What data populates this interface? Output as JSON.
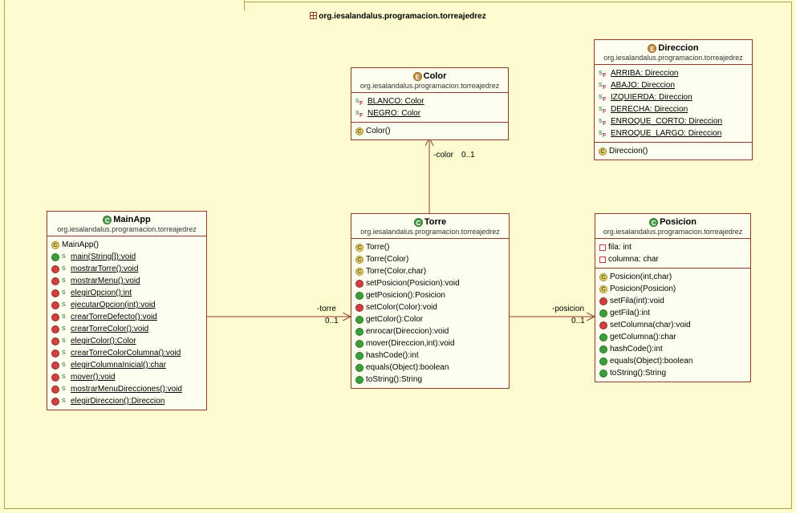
{
  "package": {
    "name": "org.iesalandalus.programacion.torreajedrez"
  },
  "classes": {
    "mainapp": {
      "stereotype": "class",
      "name": "MainApp",
      "package": "org.iesalandalus.programacion.torreajedrez",
      "attributes": [],
      "operations": [
        {
          "vis": "public",
          "static": false,
          "constructor": true,
          "sig": "MainApp()"
        },
        {
          "vis": "public",
          "static": true,
          "constructor": false,
          "sig": "main(String[]):void"
        },
        {
          "vis": "private",
          "static": true,
          "constructor": false,
          "sig": "mostrarTorre():void"
        },
        {
          "vis": "private",
          "static": true,
          "constructor": false,
          "sig": "mostrarMenu():void"
        },
        {
          "vis": "private",
          "static": true,
          "constructor": false,
          "sig": "elegirOpcion():int"
        },
        {
          "vis": "private",
          "static": true,
          "constructor": false,
          "sig": "ejecutarOpcion(int):void"
        },
        {
          "vis": "private",
          "static": true,
          "constructor": false,
          "sig": "crearTorreDefecto():void"
        },
        {
          "vis": "private",
          "static": true,
          "constructor": false,
          "sig": "crearTorreColor():void"
        },
        {
          "vis": "private",
          "static": true,
          "constructor": false,
          "sig": "elegirColor():Color"
        },
        {
          "vis": "private",
          "static": true,
          "constructor": false,
          "sig": "crearTorreColorColumna():void"
        },
        {
          "vis": "private",
          "static": true,
          "constructor": false,
          "sig": "elegirColumnaInicial():char"
        },
        {
          "vis": "private",
          "static": true,
          "constructor": false,
          "sig": "mover():void"
        },
        {
          "vis": "private",
          "static": true,
          "constructor": false,
          "sig": "mostrarMenuDirecciones():void"
        },
        {
          "vis": "private",
          "static": true,
          "constructor": false,
          "sig": "elegirDireccion():Direccion"
        }
      ]
    },
    "torre": {
      "stereotype": "class",
      "name": "Torre",
      "package": "org.iesalandalus.programacion.torreajedrez",
      "attributes": [],
      "operations": [
        {
          "vis": "public",
          "static": false,
          "constructor": true,
          "sig": "Torre()"
        },
        {
          "vis": "public",
          "static": false,
          "constructor": true,
          "sig": "Torre(Color)"
        },
        {
          "vis": "public",
          "static": false,
          "constructor": true,
          "sig": "Torre(Color,char)"
        },
        {
          "vis": "private",
          "static": false,
          "constructor": false,
          "sig": "setPosicion(Posicion):void"
        },
        {
          "vis": "public",
          "static": false,
          "constructor": false,
          "sig": "getPosicion():Posicion"
        },
        {
          "vis": "private",
          "static": false,
          "constructor": false,
          "sig": "setColor(Color):void"
        },
        {
          "vis": "public",
          "static": false,
          "constructor": false,
          "sig": "getColor():Color"
        },
        {
          "vis": "public",
          "static": false,
          "constructor": false,
          "sig": "enrocar(Direccion):void"
        },
        {
          "vis": "public",
          "static": false,
          "constructor": false,
          "sig": "mover(Direccion,int):void"
        },
        {
          "vis": "public",
          "static": false,
          "constructor": false,
          "sig": "hashCode():int"
        },
        {
          "vis": "public",
          "static": false,
          "constructor": false,
          "sig": "equals(Object):boolean"
        },
        {
          "vis": "public",
          "static": false,
          "constructor": false,
          "sig": "toString():String"
        }
      ]
    },
    "posicion": {
      "stereotype": "class",
      "name": "Posicion",
      "package": "org.iesalandalus.programacion.torreajedrez",
      "attributes": [
        {
          "vis": "private",
          "sig": "fila: int"
        },
        {
          "vis": "private",
          "sig": "columna: char"
        }
      ],
      "operations": [
        {
          "vis": "public",
          "static": false,
          "constructor": true,
          "sig": "Posicion(int,char)"
        },
        {
          "vis": "public",
          "static": false,
          "constructor": true,
          "sig": "Posicion(Posicion)"
        },
        {
          "vis": "private",
          "static": false,
          "constructor": false,
          "sig": "setFila(int):void"
        },
        {
          "vis": "public",
          "static": false,
          "constructor": false,
          "sig": "getFila():int"
        },
        {
          "vis": "private",
          "static": false,
          "constructor": false,
          "sig": "setColumna(char):void"
        },
        {
          "vis": "public",
          "static": false,
          "constructor": false,
          "sig": "getColumna():char"
        },
        {
          "vis": "public",
          "static": false,
          "constructor": false,
          "sig": "hashCode():int"
        },
        {
          "vis": "public",
          "static": false,
          "constructor": false,
          "sig": "equals(Object):boolean"
        },
        {
          "vis": "public",
          "static": false,
          "constructor": false,
          "sig": "toString():String"
        }
      ]
    },
    "color": {
      "stereotype": "enum",
      "name": "Color",
      "package": "org.iesalandalus.programacion.torreajedrez",
      "literals": [
        {
          "sig": "BLANCO: Color"
        },
        {
          "sig": "NEGRO: Color"
        }
      ],
      "operations": [
        {
          "vis": "public",
          "static": false,
          "constructor": true,
          "sig": "Color()"
        }
      ]
    },
    "direccion": {
      "stereotype": "enum",
      "name": "Direccion",
      "package": "org.iesalandalus.programacion.torreajedrez",
      "literals": [
        {
          "sig": "ARRIBA: Direccion"
        },
        {
          "sig": "ABAJO: Direccion"
        },
        {
          "sig": "IZQUIERDA: Direccion"
        },
        {
          "sig": "DERECHA: Direccion"
        },
        {
          "sig": "ENROQUE_CORTO: Direccion"
        },
        {
          "sig": "ENROQUE_LARGO: Direccion"
        }
      ],
      "operations": [
        {
          "vis": "public",
          "static": false,
          "constructor": true,
          "sig": "Direccion()"
        }
      ]
    }
  },
  "relations": {
    "torre_color": {
      "role": "-color",
      "mult": "0..1"
    },
    "mainapp_torre": {
      "role": "-torre",
      "mult": "0..1"
    },
    "torre_posicion": {
      "role": "-posicion",
      "mult": "0..1"
    }
  }
}
